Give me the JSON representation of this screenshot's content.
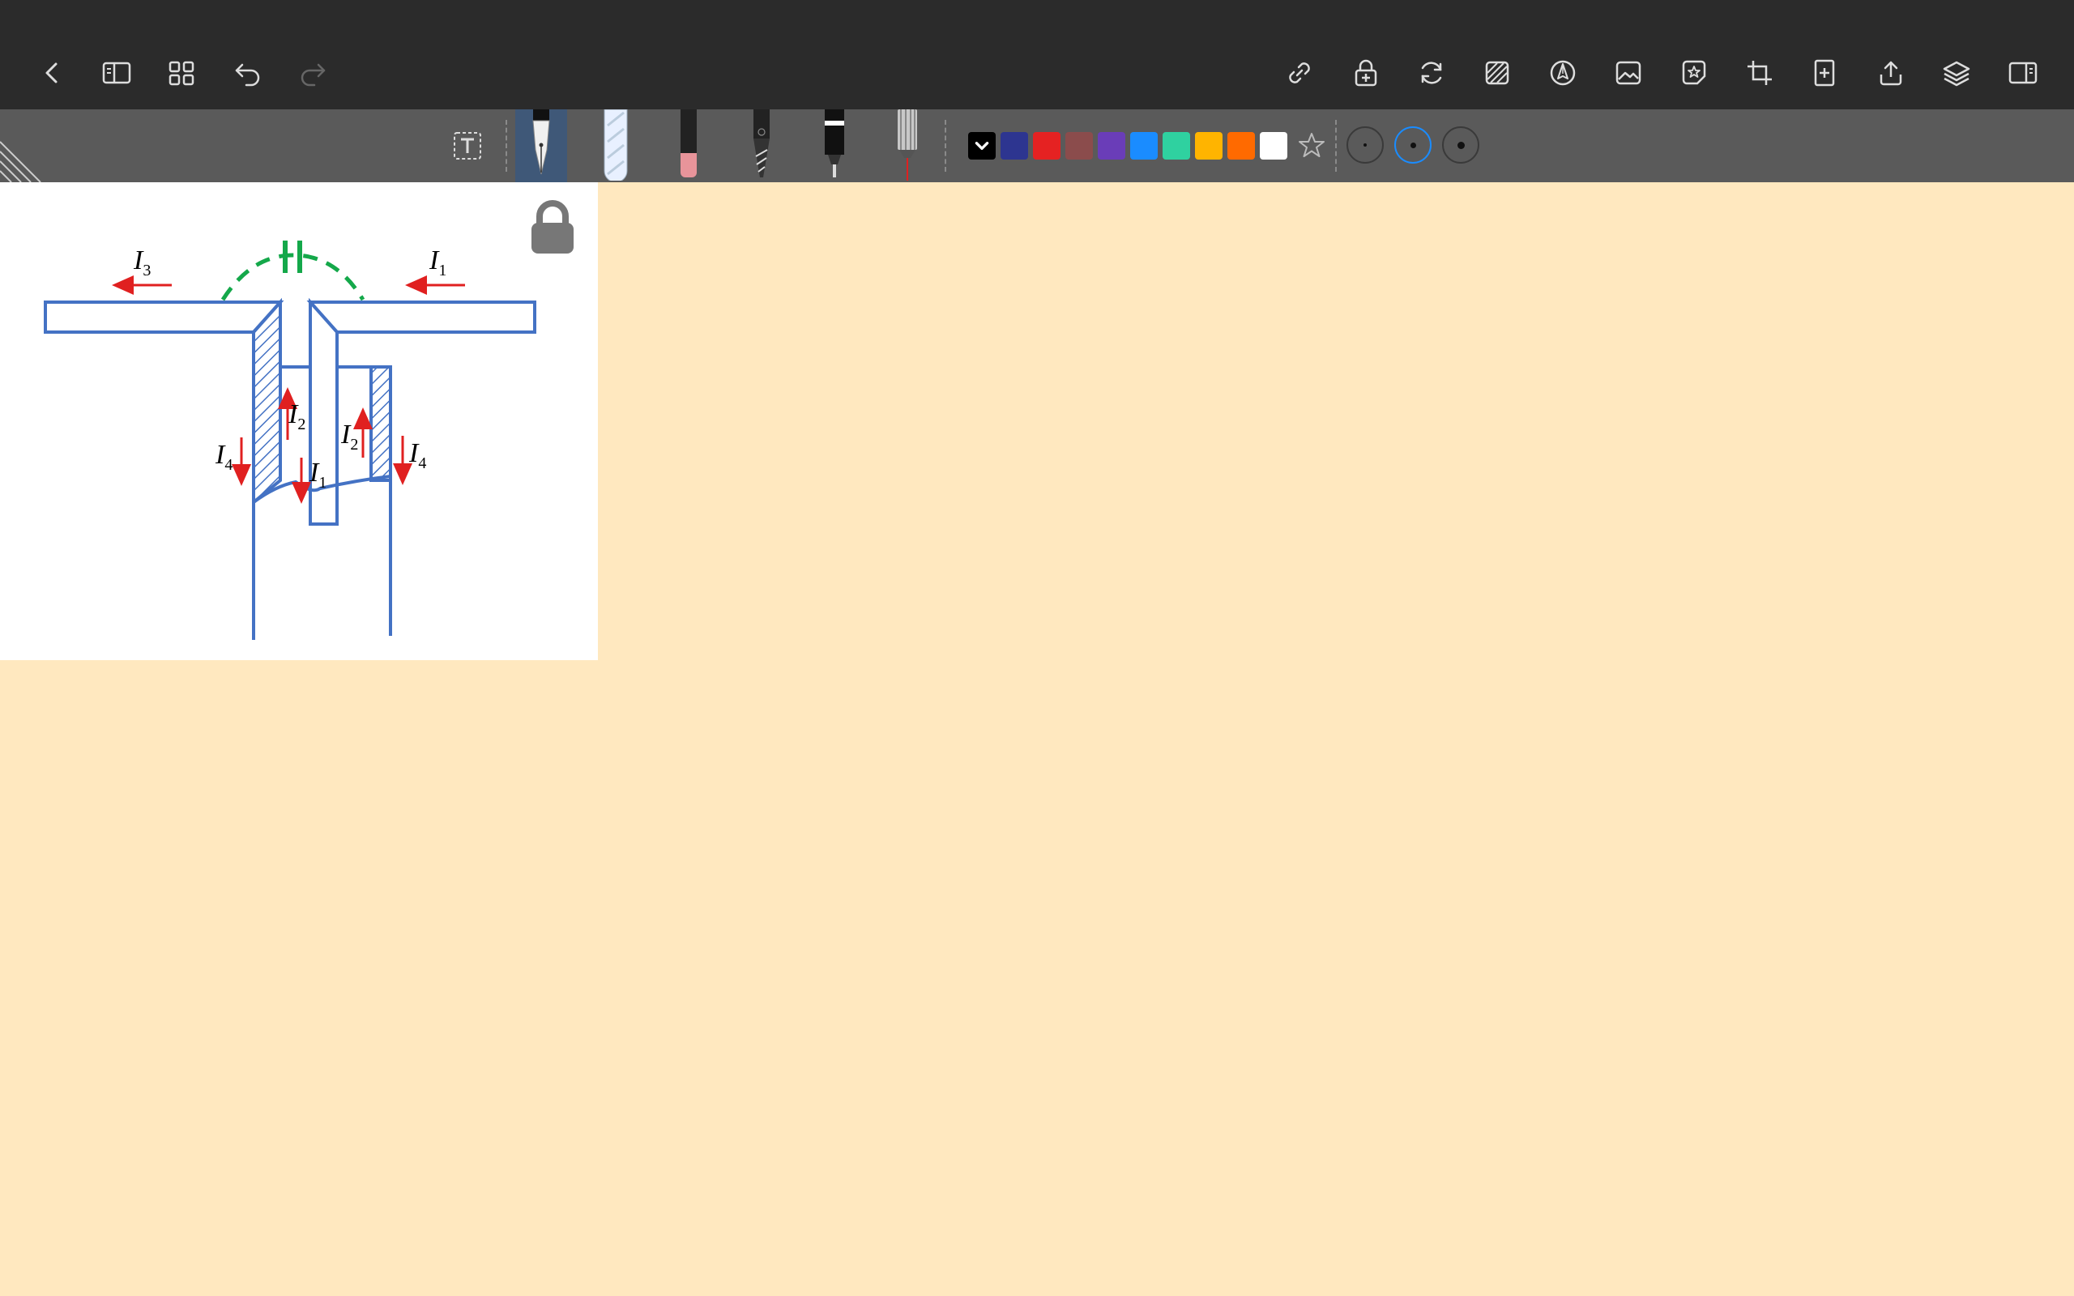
{
  "top_bar": {
    "left_buttons": [
      {
        "name": "back",
        "icon": "chevron-left-icon"
      },
      {
        "name": "sidebar",
        "icon": "sidebar-left-icon"
      },
      {
        "name": "grid",
        "icon": "grid-icon"
      },
      {
        "name": "undo",
        "icon": "undo-icon"
      },
      {
        "name": "redo",
        "icon": "redo-icon",
        "disabled": true
      }
    ],
    "right_buttons": [
      {
        "name": "link",
        "icon": "link-icon"
      },
      {
        "name": "lock-add",
        "icon": "lock-plus-icon"
      },
      {
        "name": "rotate",
        "icon": "rotate-icon"
      },
      {
        "name": "pattern",
        "icon": "hatch-icon"
      },
      {
        "name": "pen-tool",
        "icon": "pen-nib-icon"
      },
      {
        "name": "image",
        "icon": "image-icon"
      },
      {
        "name": "sticker",
        "icon": "sticker-star-icon"
      },
      {
        "name": "crop",
        "icon": "crop-icon"
      },
      {
        "name": "add-page",
        "icon": "add-page-icon"
      },
      {
        "name": "share",
        "icon": "share-icon"
      },
      {
        "name": "layers",
        "icon": "layers-icon"
      },
      {
        "name": "right-panel",
        "icon": "sidebar-right-icon"
      }
    ]
  },
  "tool_bar": {
    "tools": [
      "text-tool",
      "fountain-pen",
      "highlighter",
      "eraser",
      "brush-pen",
      "marker",
      "laser-pointer"
    ],
    "active_tool": "fountain-pen",
    "colors": [
      "#000000",
      "#2d3590",
      "#e52222",
      "#8b4c4c",
      "#6a3db8",
      "#1a8cff",
      "#2fd1a0",
      "#ffb400",
      "#ff6a00",
      "#ffffff"
    ],
    "selected_color": "#000000",
    "sizes": [
      "small",
      "medium",
      "large"
    ],
    "selected_size": "medium"
  },
  "diagram": {
    "labels": {
      "i3": "I",
      "i3_sub": "3",
      "i1_top": "I",
      "i1_top_sub": "1",
      "i4_left": "I",
      "i4_left_sub": "4",
      "i2_left": "I",
      "i2_left_sub": "2",
      "i1_mid": "I",
      "i1_mid_sub": "1",
      "i2_right": "I",
      "i2_right_sub": "2",
      "i4_right": "I",
      "i4_right_sub": "4"
    },
    "colors": {
      "structure": "#4472c4",
      "arrows": "#e02020",
      "capacitor": "#14a84a"
    },
    "locked": true
  }
}
